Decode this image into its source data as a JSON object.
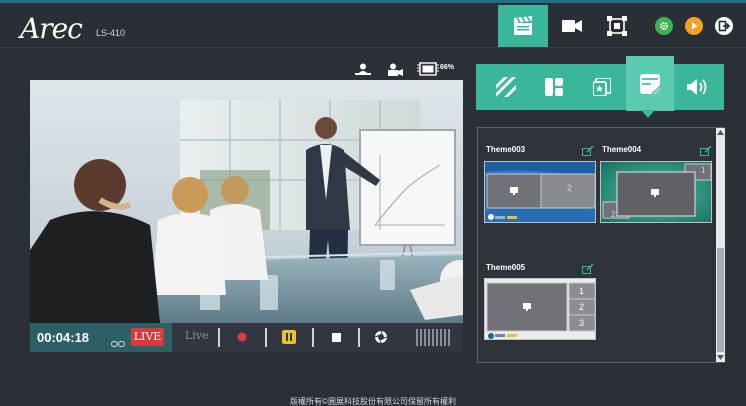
{
  "app": {
    "logo": "Arec",
    "model": "LS-410",
    "accent": "#3ab79b",
    "top_icons": [
      "scene-clapper-icon",
      "camera-icon",
      "layout-frame-icon"
    ],
    "round_icons": [
      "settings-icon",
      "playback-icon",
      "logout-icon"
    ]
  },
  "preview": {
    "status_icons": [
      "camera-detect-icon",
      "camera-record-icon",
      "storage-icon"
    ],
    "storage_percent": "66%",
    "timer": "00:04:18",
    "live_badge": "LIVE",
    "live_button": "Live",
    "controls": [
      "record-icon",
      "pause-icon",
      "stop-icon",
      "snapshot-icon",
      "audio-meter-icon"
    ]
  },
  "panel": {
    "tabs": [
      "background-icon",
      "layout-icon",
      "overlay-icon",
      "theme-icon",
      "audio-icon"
    ],
    "active_tab": 3,
    "themes": [
      {
        "name": "Theme003",
        "cells": [
          "2"
        ]
      },
      {
        "name": "Theme004",
        "cells": [
          "1",
          "2"
        ]
      },
      {
        "name": "Theme005",
        "cells": [
          "1",
          "2",
          "3"
        ]
      }
    ]
  },
  "footer": "版權所有©圓展科技股份有限公司保留所有權利"
}
